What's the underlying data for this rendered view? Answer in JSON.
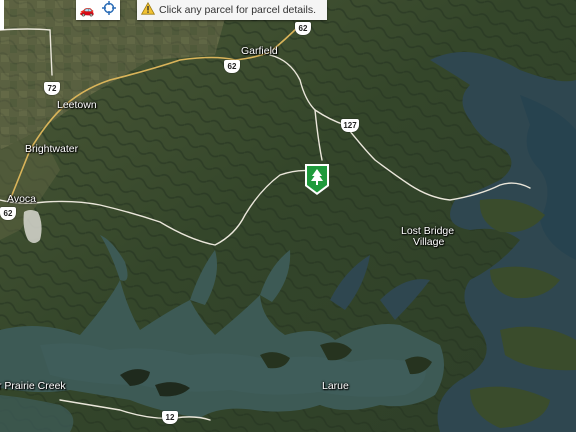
{
  "toolbar": {
    "car_icon": "car-icon",
    "locate_icon": "crosshair-icon"
  },
  "notice": {
    "icon": "warning-icon",
    "text": "Click any parcel for parcel details."
  },
  "marker": {
    "icon": "tree-icon",
    "color": "#1f9a3c"
  },
  "places": {
    "garfield": "Garfield",
    "leetown": "Leetown",
    "brightwater": "Brightwater",
    "avoca": "Avoca",
    "lost_bridge_village_1": "Lost Bridge",
    "lost_bridge_village_2": "Village",
    "prairie_creek": "r Prairie Creek",
    "larue": "Larue"
  },
  "routes": {
    "r62_a": "62",
    "r62_b": "62",
    "r72": "72",
    "r127": "127",
    "r62_c": "62",
    "r12": "12"
  },
  "colors": {
    "forest": "#34462a",
    "lake": "#2f4750",
    "water_deep": "#27434f",
    "road": "#eae6da",
    "highway": "#d9b45a"
  }
}
